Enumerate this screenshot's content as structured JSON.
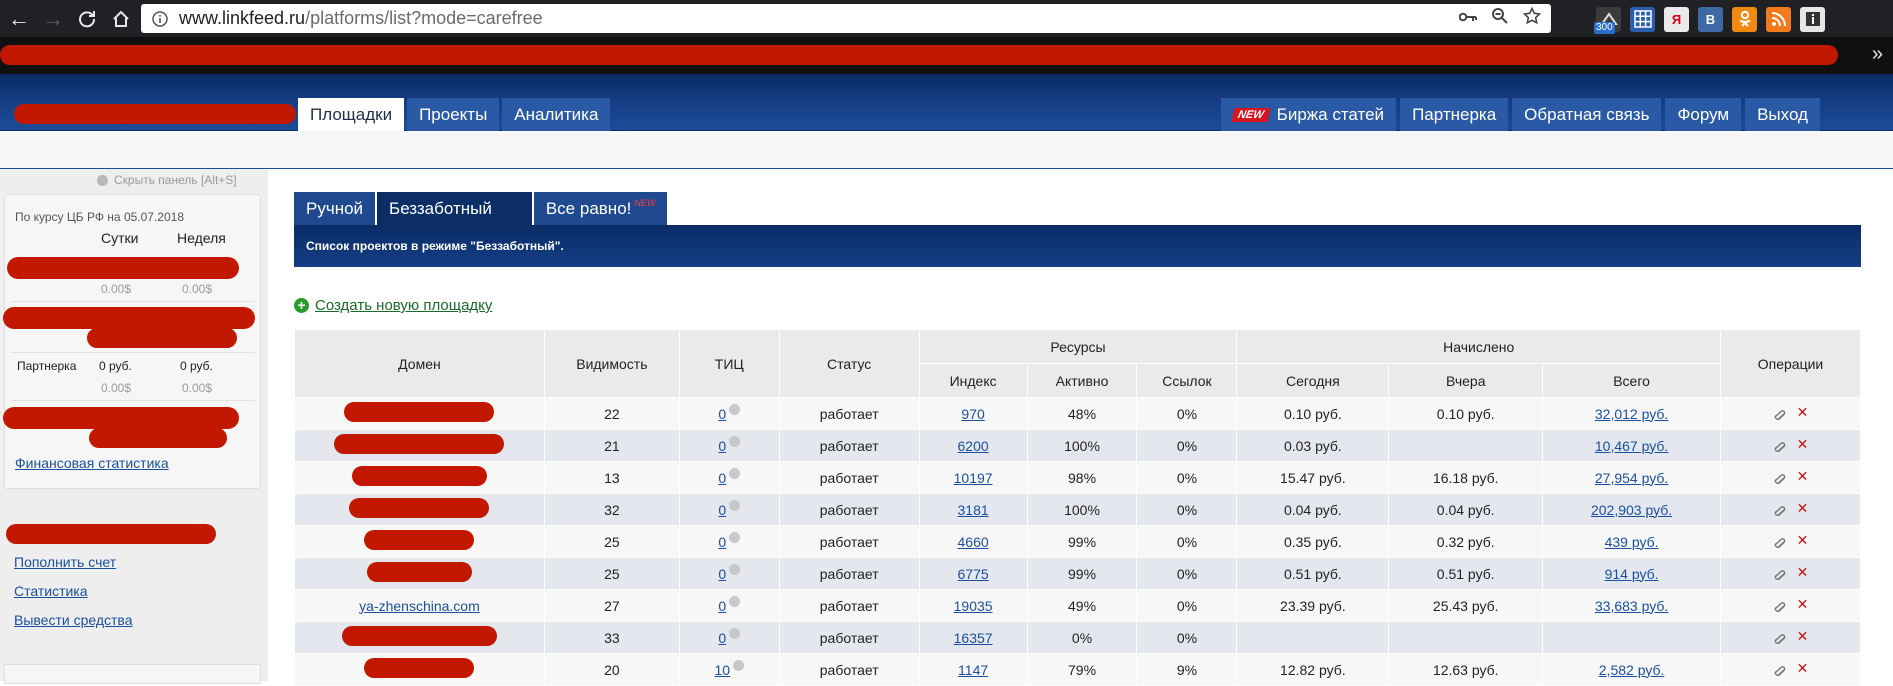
{
  "browser": {
    "url_host": "www.linkfeed.ru",
    "url_path": "/platforms/list?mode=carefree",
    "ext_badge": "300",
    "ext_vk": "B",
    "more": "»"
  },
  "header": {
    "tabs_left": [
      "Площадки",
      "Проекты",
      "Аналитика"
    ],
    "active_tab": "Площадки",
    "new_badge": "NEW",
    "tabs_right": [
      "Биржа статей",
      "Партнерка",
      "Обратная связь",
      "Форум",
      "Выход"
    ]
  },
  "sidebar": {
    "hide_panel": "Скрыть панель [Alt+S]",
    "rate_note": "По курсу ЦБ РФ на 05.07.2018",
    "col_day": "Сутки",
    "col_week": "Неделя",
    "row1_day": "0.00$",
    "row1_week": "0.00$",
    "partner_label": "Партнерка",
    "partner_day": "0 руб.",
    "partner_week": "0 руб.",
    "partner_day_usd": "0.00$",
    "partner_week_usd": "0.00$",
    "fin_stats_link": "Финансовая статистика",
    "links": [
      "Пополнить счет",
      "Статистика",
      "Вывести средства"
    ]
  },
  "main": {
    "mode_tabs": [
      "Ручной",
      "Беззаботный",
      "Все равно!"
    ],
    "active_mode": "Беззаботный",
    "mode_new": "NEW",
    "mode_desc": "Список проектов в режиме \"Беззаботный\".",
    "create_link": "Создать новую площадку"
  },
  "table": {
    "headers": {
      "domain": "Домен",
      "visibility": "Видимость",
      "tic": "ТИЦ",
      "status": "Статус",
      "resources": "Ресурсы",
      "index": "Индекс",
      "active": "Активно",
      "links": "Ссылок",
      "accrued": "Начислено",
      "today": "Сегодня",
      "yesterday": "Вчера",
      "total": "Всего",
      "operations": "Операции"
    },
    "rows": [
      {
        "domain": "",
        "visibility": "22",
        "tic": "0",
        "status": "работает",
        "index": "970",
        "active": "48%",
        "links": "0%",
        "today": "0.10 руб.",
        "yesterday": "0.10 руб.",
        "total": "32,012 руб."
      },
      {
        "domain": "",
        "visibility": "21",
        "tic": "0",
        "status": "работает",
        "index": "6200",
        "active": "100%",
        "links": "0%",
        "today": "0.03 руб.",
        "yesterday": "",
        "total": "10,467 руб."
      },
      {
        "domain": "",
        "visibility": "13",
        "tic": "0",
        "status": "работает",
        "index": "10197",
        "active": "98%",
        "links": "0%",
        "today": "15.47 руб.",
        "yesterday": "16.18 руб.",
        "total": "27,954 руб."
      },
      {
        "domain": "",
        "visibility": "32",
        "tic": "0",
        "status": "работает",
        "index": "3181",
        "active": "100%",
        "links": "0%",
        "today": "0.04 руб.",
        "yesterday": "0.04 руб.",
        "total": "202,903 руб."
      },
      {
        "domain": "",
        "visibility": "25",
        "tic": "0",
        "status": "работает",
        "index": "4660",
        "active": "99%",
        "links": "0%",
        "today": "0.35 руб.",
        "yesterday": "0.32 руб.",
        "total": "439 руб."
      },
      {
        "domain": "",
        "visibility": "25",
        "tic": "0",
        "status": "работает",
        "index": "6775",
        "active": "99%",
        "links": "0%",
        "today": "0.51 руб.",
        "yesterday": "0.51 руб.",
        "total": "914 руб."
      },
      {
        "domain": "ya-zhenschina.com",
        "visibility": "27",
        "tic": "0",
        "status": "работает",
        "index": "19035",
        "active": "49%",
        "links": "0%",
        "today": "23.39 руб.",
        "yesterday": "25.43 руб.",
        "total": "33,683 руб."
      },
      {
        "domain": "",
        "visibility": "33",
        "tic": "0",
        "status": "работает",
        "index": "16357",
        "active": "0%",
        "links": "0%",
        "today": "",
        "yesterday": "",
        "total": ""
      },
      {
        "domain": "",
        "visibility": "20",
        "tic": "10",
        "status": "работает",
        "index": "1147",
        "active": "79%",
        "links": "9%",
        "today": "12.82 руб.",
        "yesterday": "12.63 руб.",
        "total": "2,582 руб."
      }
    ]
  },
  "colors": {
    "accent_blue": "#1b4c98",
    "redaction": "#c21800",
    "delete": "#c0151b"
  }
}
